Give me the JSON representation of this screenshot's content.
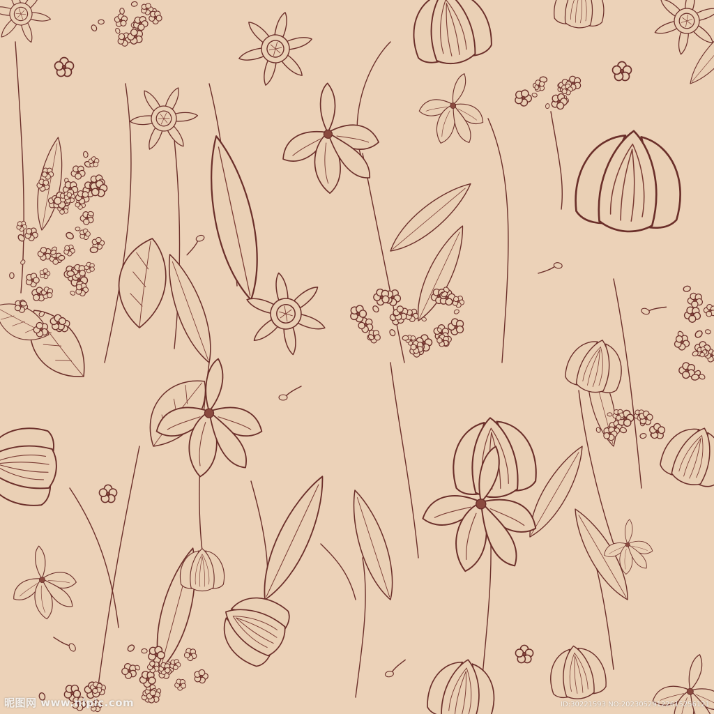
{
  "image": {
    "description_type": "seamless botanical pattern",
    "background_color": "#ecd2b8",
    "ink_color": "#6b2f2a"
  },
  "watermark": {
    "logo_text": "昵图网 www.nipic.com",
    "id_text": "ID:30221593 NO:20230529122615256121"
  }
}
